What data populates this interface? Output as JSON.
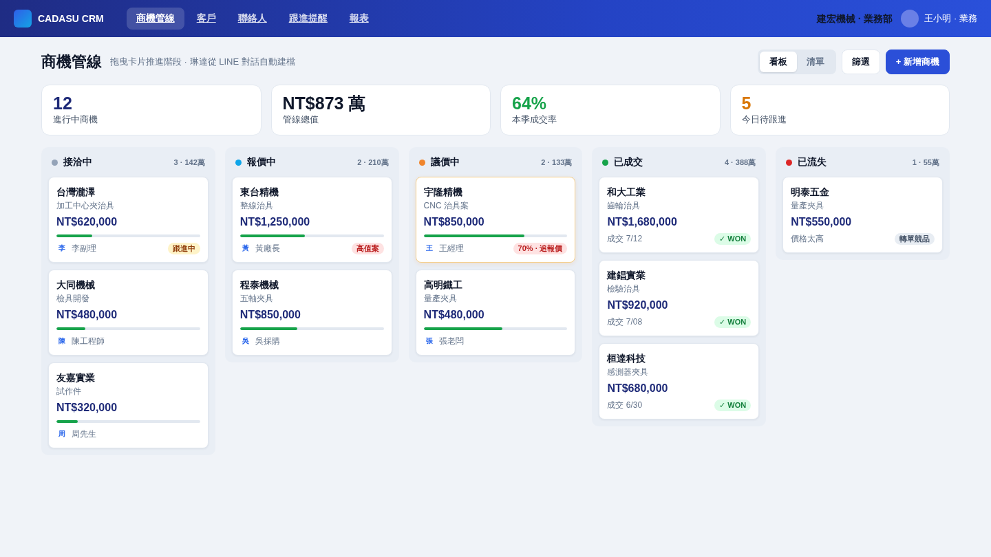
{
  "app": {
    "brand": "CADASU CRM",
    "nav": [
      {
        "label": "商機管線",
        "selected": true
      },
      {
        "label": "客戶",
        "selected": false
      },
      {
        "label": "聯絡人",
        "selected": false
      },
      {
        "label": "跟進提醒",
        "selected": false
      },
      {
        "label": "報表",
        "selected": false
      }
    ],
    "company": "建宏機械 · 業務部",
    "user": "王小明 · 業務"
  },
  "page": {
    "title": "商機管線",
    "subtitle": "拖曳卡片推進階段 · 琳達從 LINE 對話自動建檔",
    "views": [
      {
        "label": "看板",
        "selected": true
      },
      {
        "label": "清單",
        "selected": false
      }
    ],
    "actions": [
      {
        "label": "篩選",
        "kind": "filter"
      },
      {
        "label": "+ 新增商機",
        "kind": "create"
      }
    ]
  },
  "stats": [
    {
      "value": "12",
      "label": "進行中商機",
      "color": "#1e2a78"
    },
    {
      "value": "NT$873 萬",
      "label": "管線總值",
      "color": "#0f172a"
    },
    {
      "value": "64%",
      "label": "本季成交率",
      "color": "#16a34a"
    },
    {
      "value": "5",
      "label": "今日待跟進",
      "color": "#d97706"
    }
  ],
  "columns": [
    {
      "name": "接洽中",
      "color": "#94a3b8",
      "summary": "3 · 142萬",
      "cards": [
        {
          "kind": "open",
          "company": "台灣瀧澤",
          "product": "加工中心夾治具",
          "amount": "NT$620,000",
          "level": 0.25,
          "initial": "李",
          "contact": "李副理",
          "tag": {
            "text": "跟進中",
            "kind": "warning"
          },
          "highlighted": false
        },
        {
          "kind": "open",
          "company": "大同機械",
          "product": "檢具開發",
          "amount": "NT$480,000",
          "level": 0.2,
          "initial": "陳",
          "contact": "陳工程師",
          "highlighted": false
        },
        {
          "kind": "open",
          "company": "友嘉實業",
          "product": "試作件",
          "amount": "NT$320,000",
          "level": 0.15,
          "initial": "周",
          "contact": "周先生",
          "highlighted": false
        }
      ]
    },
    {
      "name": "報價中",
      "color": "#0ea5e9",
      "summary": "2 · 210萬",
      "cards": [
        {
          "kind": "open",
          "company": "東台精機",
          "product": "整線治具",
          "amount": "NT$1,250,000",
          "level": 0.45,
          "initial": "黃",
          "contact": "黃廠長",
          "tag": {
            "text": "高值案",
            "kind": "danger"
          },
          "highlighted": false
        },
        {
          "kind": "open",
          "company": "程泰機械",
          "product": "五軸夾具",
          "amount": "NT$850,000",
          "level": 0.4,
          "initial": "吳",
          "contact": "吳採購",
          "highlighted": false
        }
      ]
    },
    {
      "name": "議價中",
      "color": "#f0852d",
      "summary": "2 · 133萬",
      "cards": [
        {
          "kind": "open",
          "company": "宇隆精機",
          "product": "CNC 治具案",
          "amount": "NT$850,000",
          "level": 0.7,
          "initial": "王",
          "contact": "王經理",
          "tag": {
            "text": "70% · 追報價",
            "kind": "danger"
          },
          "highlighted": true
        },
        {
          "kind": "open",
          "company": "高明鐵工",
          "product": "量產夾具",
          "amount": "NT$480,000",
          "level": 0.55,
          "initial": "張",
          "contact": "張老闆",
          "highlighted": false
        }
      ]
    },
    {
      "name": "已成交",
      "color": "#16a34a",
      "summary": "4 · 388萬",
      "cards": [
        {
          "kind": "closed",
          "company": "和大工業",
          "product": "齒輪治具",
          "amount": "NT$1,680,000",
          "note": "成交 7/12",
          "tag": {
            "text": "✓ WON",
            "kind": "success"
          },
          "highlighted": false
        },
        {
          "kind": "closed",
          "company": "建錩實業",
          "product": "檢驗治具",
          "amount": "NT$920,000",
          "note": "成交 7/08",
          "tag": {
            "text": "✓ WON",
            "kind": "success"
          },
          "highlighted": false
        },
        {
          "kind": "closed",
          "company": "桓達科技",
          "product": "感測器夾具",
          "amount": "NT$680,000",
          "note": "成交 6/30",
          "tag": {
            "text": "✓ WON",
            "kind": "success"
          },
          "highlighted": false
        }
      ]
    },
    {
      "name": "已流失",
      "color": "#dc2626",
      "summary": "1 · 55萬",
      "cards": [
        {
          "kind": "closed",
          "company": "明泰五金",
          "product": "量產夾具",
          "amount": "NT$550,000",
          "note": "價格太高",
          "tag": {
            "text": "轉單競品",
            "kind": "neutral"
          },
          "highlighted": false
        }
      ]
    }
  ]
}
